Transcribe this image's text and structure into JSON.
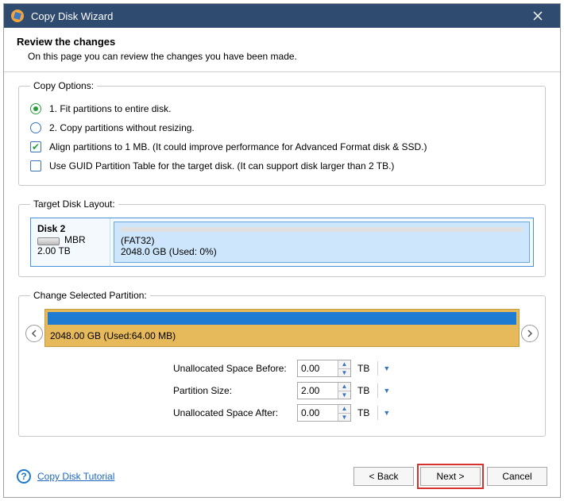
{
  "titlebar": {
    "title": "Copy Disk Wizard"
  },
  "header": {
    "title": "Review the changes",
    "subtitle": "On this page you can review the changes you have been made."
  },
  "copy_options": {
    "legend": "Copy Options:",
    "radio1": "1. Fit partitions to entire disk.",
    "radio2": "2. Copy partitions without resizing.",
    "check1": "Align partitions to 1 MB.  (It could improve performance for Advanced Format disk & SSD.)",
    "check2": "Use GUID Partition Table for the target disk. (It can support disk larger than 2 TB.)"
  },
  "target_layout": {
    "legend": "Target Disk Layout:",
    "disk_name": "Disk 2",
    "disk_scheme": "MBR",
    "disk_size": "2.00 TB",
    "part_fs": "(FAT32)",
    "part_usage": "2048.0 GB (Used: 0%)"
  },
  "change_partition": {
    "legend": "Change Selected Partition:",
    "part_label": "2048.00 GB (Used:64.00 MB)",
    "fields": {
      "before_label": "Unallocated Space Before:",
      "before_value": "0.00",
      "before_unit": "TB",
      "size_label": "Partition Size:",
      "size_value": "2.00",
      "size_unit": "TB",
      "after_label": "Unallocated Space After:",
      "after_value": "0.00",
      "after_unit": "TB"
    }
  },
  "footer": {
    "tutorial": "Copy Disk Tutorial",
    "back": "< Back",
    "next": "Next >",
    "cancel": "Cancel"
  }
}
